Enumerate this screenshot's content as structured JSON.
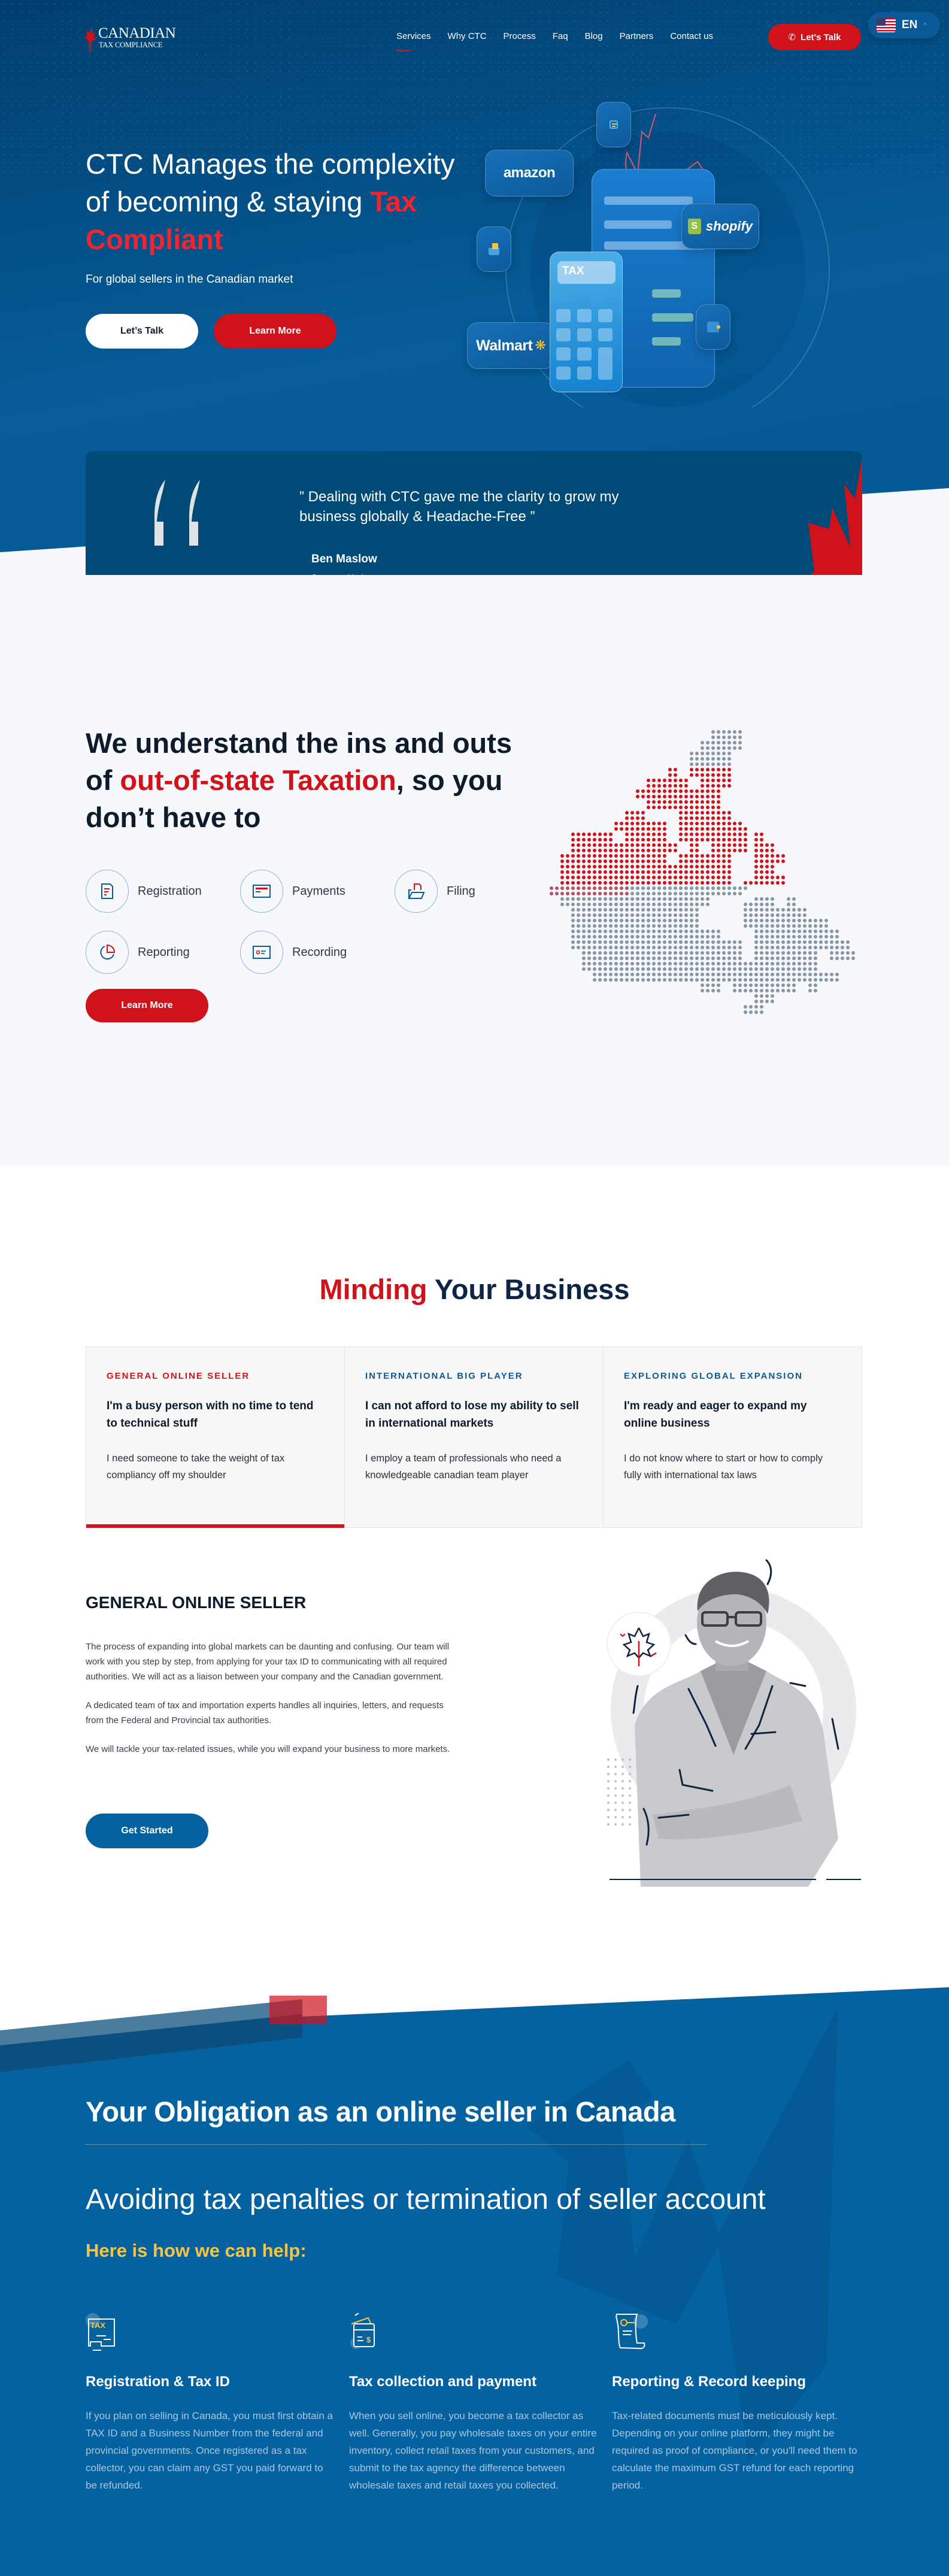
{
  "nav": {
    "logo_line1": "CANADIAN",
    "logo_line2": "TAX COMPLIANCE",
    "links": [
      {
        "label": "Services",
        "active": true
      },
      {
        "label": "Why CTC",
        "active": false
      },
      {
        "label": "Process",
        "active": false
      },
      {
        "label": "Faq",
        "active": false
      },
      {
        "label": "Blog",
        "active": false
      },
      {
        "label": "Partners",
        "active": false
      },
      {
        "label": "Contact us",
        "active": false
      }
    ],
    "cta_label": "Let's Talk",
    "cta_icon": "phone-icon",
    "language": {
      "code": "EN",
      "flag": "us-flag-icon",
      "caret": "^"
    }
  },
  "hero": {
    "title_prefix": "CTC Manages the complexity of becoming & staying ",
    "title_accent": "Tax Compliant",
    "subtitle": "For global sellers in the Canadian market",
    "btn_primary": "Let’s Talk",
    "btn_secondary": "Learn More",
    "illustration": {
      "brands": [
        "amazon",
        "shopify",
        "Walmart"
      ],
      "calculator_label": "TAX"
    }
  },
  "testimonial": {
    "quote": "” Dealing with CTC gave me the clarity to grow my business globally & Headache-Free ”",
    "name": "Ben Maslow",
    "company": "Company: Machrus"
  },
  "understand": {
    "title_prefix": "We understand the ins and outs of ",
    "title_accent": "out-of-state Taxation",
    "title_suffix": ", so you don’t have to",
    "services": [
      {
        "label": "Registration",
        "icon": "document-icon"
      },
      {
        "label": "Payments",
        "icon": "card-icon"
      },
      {
        "label": "Filing",
        "icon": "folder-icon"
      },
      {
        "label": "Reporting",
        "icon": "pie-chart-icon"
      },
      {
        "label": "Recording",
        "icon": "id-card-icon"
      }
    ],
    "cta_label": "Learn More"
  },
  "minding": {
    "title_accent": "Minding",
    "title_rest": " Your Business",
    "cards": [
      {
        "tag": "GENERAL ONLINE SELLER",
        "tag_color": "#d0121b",
        "heading": "I'm a busy person with no time to tend to technical stuff",
        "body": "I need someone to take the weight of tax compliancy off my shoulder",
        "active": true
      },
      {
        "tag": "INTERNATIONAL BIG PLAYER",
        "tag_color": "#0a5a98",
        "heading": "I can not afford to lose my ability to sell in international markets",
        "body": "I employ a team of professionals who need a knowledgeable canadian team player",
        "active": false
      },
      {
        "tag": "EXPLORING GLOBAL EXPANSION",
        "tag_color": "#0a5a98",
        "heading": "I'm ready and eager to expand my online business",
        "body": "I do not know where to start or how to comply fully with international tax laws",
        "active": false
      }
    ],
    "detail": {
      "title": "GENERAL ONLINE SELLER",
      "paragraphs": [
        "The process of expanding into global markets can be daunting and confusing. Our team will work with you step by step, from applying for your tax ID to communicating with all required authorities. We will act as a liaison between your company and the Canadian government.",
        "A dedicated team of tax and importation experts handles all inquiries, letters, and requests from the Federal and Provincial tax authorities.",
        "We will tackle your tax-related issues, while you will expand your business to more markets."
      ],
      "cta_label": "Get Started"
    }
  },
  "obligation": {
    "title": "Your Obligation as an online seller in Canada",
    "subtitle": "Avoiding tax penalties or termination of seller account",
    "help": "Here is how we can help:",
    "features": [
      {
        "icon": "tax-monitor-icon",
        "icon_label": "TAX",
        "title": "Registration & Tax ID",
        "body": "If you plan on selling in Canada, you must first obtain a TAX ID and a Business Number from the federal and provincial governments. Once registered as a tax collector, you can claim any GST you paid forward to be refunded."
      },
      {
        "icon": "wallet-cards-icon",
        "icon_label": "$",
        "title": "Tax collection and payment",
        "body": "When you sell online, you become a tax collector as well. Generally, you pay wholesale taxes on your entire inventory, collect retail taxes from your customers, and submit to the tax agency the difference between wholesale taxes and retail taxes you collected."
      },
      {
        "icon": "scroll-document-icon",
        "icon_label": "",
        "title": "Reporting & Record keeping",
        "body": "Tax-related documents must be meticulously kept. Depending on your online platform, they might be required as proof of compliance, or you'll need them to calculate the maximum GST refund for each reporting period."
      }
    ]
  },
  "colors": {
    "brand_red": "#d0121b",
    "brand_navy": "#004a77",
    "brand_blue": "#0562a0",
    "accent_yellow": "#f5c542",
    "page_bg_light": "#f7f8fc"
  }
}
